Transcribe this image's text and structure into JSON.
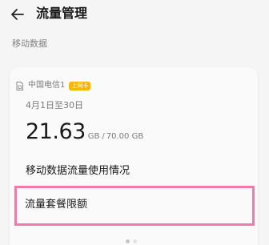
{
  "header": {
    "title": "流量管理",
    "back_icon": "back-arrow-icon"
  },
  "section": {
    "label": "移动数据"
  },
  "card": {
    "sim_icon": "sim-card-icon",
    "carrier": "中国电信1",
    "badge": "上网卡",
    "period": "4月1日至30日",
    "used_value": "21.63",
    "used_unit": "GB",
    "separator": "/",
    "total": "70.00 GB"
  },
  "menu": {
    "usage_label": "移动数据流量使用情况",
    "limit_label": "流量套餐限额"
  },
  "pager": {
    "pages": 2,
    "active_index": 0
  },
  "colors": {
    "badge": "#f5b700",
    "highlight_border": "#f07aa8",
    "background": "#f5f5f5"
  }
}
